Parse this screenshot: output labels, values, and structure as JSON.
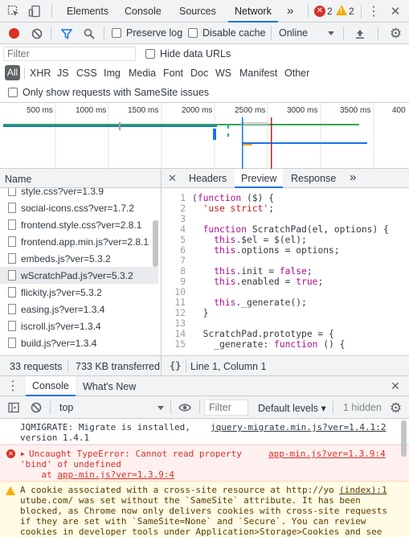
{
  "main_toolbar": {
    "tabs": [
      "Elements",
      "Console",
      "Sources",
      "Network"
    ],
    "active_tab": "Network",
    "more_label": "»",
    "error_count": "2",
    "warning_count": "2"
  },
  "network_toolbar": {
    "preserve_log": "Preserve log",
    "disable_cache": "Disable cache",
    "throttle": "Online"
  },
  "filter": {
    "placeholder": "Filter",
    "hide_data_urls": "Hide data URLs",
    "types": [
      "All",
      "XHR",
      "JS",
      "CSS",
      "Img",
      "Media",
      "Font",
      "Doc",
      "WS",
      "Manifest",
      "Other"
    ],
    "samesite": "Only show requests with SameSite issues"
  },
  "timeline": {
    "ticks": [
      "500 ms",
      "1000 ms",
      "1500 ms",
      "2000 ms",
      "2500 ms",
      "3000 ms",
      "3500 ms",
      "400"
    ]
  },
  "requests": {
    "header": "Name",
    "items": [
      "style.css?ver=1.3.9",
      "social-icons.css?ver=1.7.2",
      "frontend.style.css?ver=2.8.1",
      "frontend.app.min.js?ver=2.8.1",
      "embeds.js?ver=5.3.2",
      "wScratchPad.js?ver=5.3.2",
      "flickity.js?ver=5.3.2",
      "easing.js?ver=1.3.4",
      "iscroll.js?ver=1.3.4",
      "build.js?ver=1.3.4"
    ],
    "selected_index": 5,
    "status_requests": "33 requests",
    "status_transferred": "733 KB transferred"
  },
  "detail": {
    "tabs": [
      "Headers",
      "Preview",
      "Response"
    ],
    "active_tab": "Preview",
    "more_label": "»",
    "close": "✕",
    "status": "Line 1, Column 1",
    "braces": "{}",
    "lines": [
      {
        "n": "1",
        "text": "(function ($) {"
      },
      {
        "n": "2",
        "text": "  'use strict';"
      },
      {
        "n": "3",
        "text": ""
      },
      {
        "n": "4",
        "text": "  function ScratchPad(el, options) {"
      },
      {
        "n": "5",
        "text": "    this.$el = $(el);"
      },
      {
        "n": "6",
        "text": "    this.options = options;"
      },
      {
        "n": "7",
        "text": ""
      },
      {
        "n": "8",
        "text": "    this.init = false;"
      },
      {
        "n": "9",
        "text": "    this.enabled = true;"
      },
      {
        "n": "10",
        "text": ""
      },
      {
        "n": "11",
        "text": "    this._generate();"
      },
      {
        "n": "12",
        "text": "  }"
      },
      {
        "n": "13",
        "text": ""
      },
      {
        "n": "14",
        "text": "  ScratchPad.prototype = {"
      },
      {
        "n": "15",
        "text": "    _generate: function () {"
      }
    ]
  },
  "drawer": {
    "tabs": [
      "Console",
      "What's New"
    ],
    "active_tab": "Console",
    "context": "top",
    "filter_placeholder": "Filter",
    "levels": "Default levels ▾",
    "hidden": "1 hidden"
  },
  "console": {
    "info": {
      "text": "JQMIGRATE: Migrate is installed,\nversion 1.4.1",
      "source": "jquery-migrate.min.js?ver=1.4.1:2"
    },
    "error": {
      "line1": "Uncaught TypeError: Cannot read property",
      "line2": "'bind' of undefined",
      "line3_prefix": "    at ",
      "line3_link": "app-min.js?ver=1.3.9:4",
      "source": "app-min.js?ver=1.3.9:4"
    },
    "warning": {
      "text": "A cookie associated with a cross-site resource at http://yo\nutube.com/ was set without the `SameSite` attribute. It has been\nblocked, as Chrome now only delivers cookies with cross-site requests\nif they are set with `SameSite=None` and `Secure`. You can review\ncookies in developer tools under Application>Storage>Cookies and see",
      "source": "(index):1"
    }
  },
  "colors": {
    "accent": "#1a73e8",
    "error": "#d93025",
    "warning": "#f9ab00",
    "toolbar_bg": "#f1f3f4",
    "selected_row": "#e8eaed"
  }
}
